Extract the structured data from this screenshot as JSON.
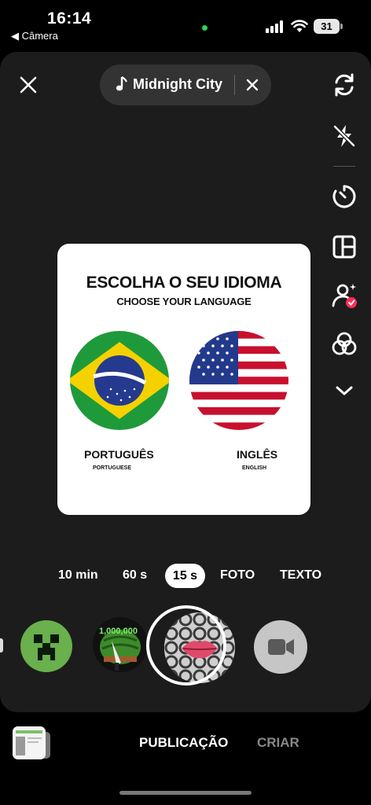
{
  "status_bar": {
    "time": "16:14",
    "back_app": "◀ Câmera",
    "battery": "31"
  },
  "music": {
    "title": "Midnight City"
  },
  "side_icons": [
    "flip-camera-icon",
    "flash-off-icon",
    "timer-icon",
    "layout-icon",
    "touch-up-icon",
    "filters-icon",
    "chevron-down-icon"
  ],
  "card": {
    "title": "ESCOLHA O SEU IDIOMA",
    "subtitle": "CHOOSE YOUR LANGUAGE",
    "left_label": "PORTUGUÊS",
    "left_sub": "PORTUGUESE",
    "right_label": "INGLÊS",
    "right_sub": "ENGLISH"
  },
  "modes": {
    "m10": "10 min",
    "m60": "60 s",
    "m15": "15 s",
    "photo": "FOTO",
    "text": "TEXTO",
    "selected": "15 s"
  },
  "effects": {
    "melon_badge": "1,000,000"
  },
  "bottom_tabs": {
    "post": "PUBLICAÇÃO",
    "create": "CRIAR"
  },
  "colors": {
    "accent_red": "#ff2d55",
    "status_green": "#2fd158"
  }
}
